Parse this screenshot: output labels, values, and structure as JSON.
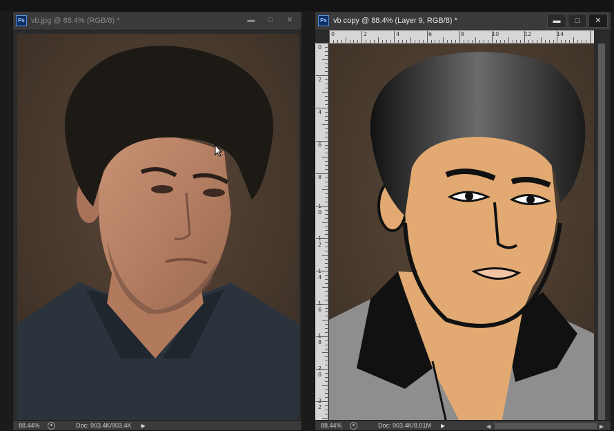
{
  "windows": [
    {
      "app_icon": "Ps",
      "title": "vb.jpg @ 88.4% (RGB/8) *",
      "controls": [
        "▬",
        "□",
        "✕"
      ],
      "status": {
        "zoom": "88.44%",
        "doc": "Doc: 903.4K/903.4K"
      }
    },
    {
      "app_icon": "Ps",
      "title": "vb copy @ 88.4% (Layer 9, RGB/8) *",
      "controls": [
        "▬",
        "□",
        "✕"
      ],
      "rulers": {
        "horizontal": [
          "0",
          "2",
          "4",
          "6",
          "8",
          "10",
          "12",
          "14"
        ],
        "vertical": [
          "0",
          "2",
          "4",
          "6",
          "8",
          "1\n0",
          "1\n2",
          "1\n4",
          "1\n6",
          "1\n8",
          "2\n0",
          "2\n2"
        ]
      },
      "status": {
        "zoom": "88.44%",
        "doc": "Doc: 903.4K/8.01M"
      }
    }
  ],
  "colors": {
    "accent_ps": "#0c2f64",
    "background_photo": "#4a3b30",
    "skin_flat": "#e2aa72",
    "shirt_gray": "#8c8c8c",
    "shirt_dark": "#2e3640"
  }
}
